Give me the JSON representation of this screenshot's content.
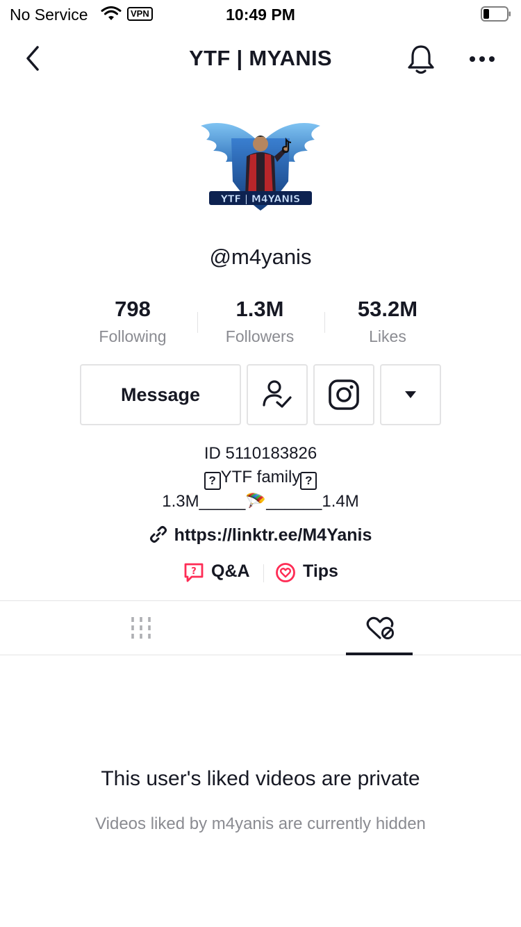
{
  "status_bar": {
    "carrier": "No Service",
    "vpn": "VPN",
    "time": "10:49 PM"
  },
  "nav": {
    "title": "YTF | MYANIS"
  },
  "profile": {
    "avatar_text": "YTF | M4YANIS",
    "username": "@m4yanis",
    "stats": [
      {
        "value": "798",
        "label": "Following"
      },
      {
        "value": "1.3M",
        "label": "Followers"
      },
      {
        "value": "53.2M",
        "label": "Likes"
      }
    ],
    "message_label": "Message",
    "bio": {
      "line1": "ID 5110183826",
      "line2_qmark": "?",
      "line2_text": "YTF family",
      "line3_left": "1.3M_____",
      "line3_emoji": "🪂",
      "line3_right": "______1.4M"
    },
    "link": "https://linktr.ee/M4Yanis",
    "qa_label": "Q&A",
    "tips_label": "Tips"
  },
  "empty_state": {
    "title": "This user's liked videos are private",
    "subtitle": "Videos liked by m4yanis are currently hidden"
  },
  "colors": {
    "text": "#161823",
    "muted": "#8a8b91",
    "border": "#e3e3e4",
    "accent": "#fe2c55"
  }
}
